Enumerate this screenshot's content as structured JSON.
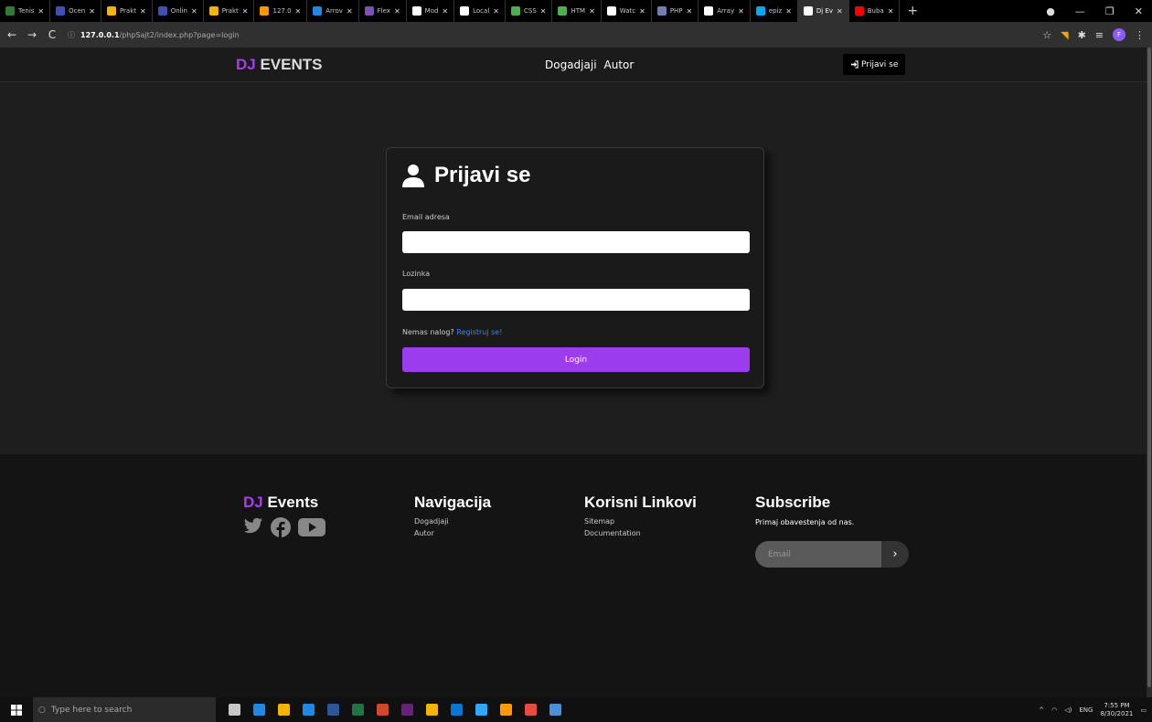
{
  "browser": {
    "tabs": [
      {
        "label": "Tenis",
        "color": "#2e7d32"
      },
      {
        "label": "Ocen",
        "color": "#3f51b5"
      },
      {
        "label": "Prakt",
        "color": "#f4b400"
      },
      {
        "label": "Onlin",
        "color": "#3f51b5"
      },
      {
        "label": "Prakt",
        "color": "#f4b400"
      },
      {
        "label": "127.0",
        "color": "#ff9800"
      },
      {
        "label": "Arrov",
        "color": "#1e88e5"
      },
      {
        "label": "Flex",
        "color": "#7952b3"
      },
      {
        "label": "Mod",
        "color": "#ffffff"
      },
      {
        "label": "Local",
        "color": "#ffffff"
      },
      {
        "label": "CSS",
        "color": "#4caf50"
      },
      {
        "label": "HTM",
        "color": "#4caf50"
      },
      {
        "label": "Watc",
        "color": "#ffffff"
      },
      {
        "label": "PHP",
        "color": "#777bb3"
      },
      {
        "label": "Array",
        "color": "#ffffff"
      },
      {
        "label": "epiz",
        "color": "#03a9f4"
      },
      {
        "label": "Dj Ev",
        "color": "#ffffff",
        "active": true
      },
      {
        "label": "Buba",
        "color": "#ff0000"
      }
    ],
    "url_host": "127.0.0.1",
    "url_path": "/phpSajt2/index.php?page=login",
    "profile_initial": "F"
  },
  "header": {
    "brand_dj": "DJ",
    "brand_rest": " EVENTS",
    "nav": [
      "Dogadjaji",
      "Autor"
    ],
    "login_button": "Prijavi se"
  },
  "login": {
    "title": "Prijavi se",
    "email_label": "Email adresa",
    "password_label": "Lozinka",
    "signup_prompt": "Nemas nalog?",
    "signup_link": "Registruj se!",
    "submit": "Login"
  },
  "footer": {
    "brand_dj": "DJ",
    "brand_rest": " Events",
    "nav_title": "Navigacija",
    "nav_links": [
      "Dogadjaji",
      "Autor"
    ],
    "useful_title": "Korisni Linkovi",
    "useful_links": [
      "Sitemap",
      "Documentation"
    ],
    "subscribe_title": "Subscribe",
    "subscribe_text": "Primaj obavestenja od nas.",
    "subscribe_placeholder": "Email"
  },
  "taskbar": {
    "search_placeholder": "Type here to search",
    "lang": "ENG",
    "time": "7:55 PM",
    "date": "8/30/2021",
    "app_colors": [
      "#c8c8c8",
      "#1e88e5",
      "#f4b400",
      "#1e88e5",
      "#2b579a",
      "#217346",
      "#d24726",
      "#68217a",
      "#f4b400",
      "#0078d4",
      "#31a8ff",
      "#ff9a00",
      "#e74c3c",
      "#4a90d9"
    ]
  },
  "colors": {
    "accent": "#9b3ded",
    "link": "#3b82f6"
  }
}
